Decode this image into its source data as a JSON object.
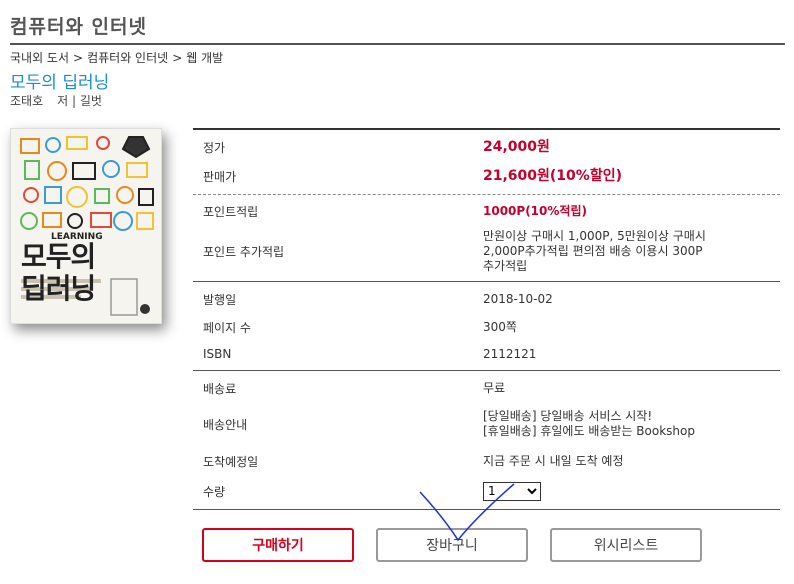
{
  "page": {
    "category_title": "컴퓨터와 인터넷"
  },
  "breadcrumb": [
    "국내외 도서",
    "컴퓨터와 인터넷",
    "웹 개발"
  ],
  "book": {
    "title": "모두의 딥러닝",
    "author": "조태호",
    "author_role": "저 | 길벗",
    "cover_title_line1": "모두의",
    "cover_title_line2": "딥러닝"
  },
  "info": {
    "price": {
      "label": "정가",
      "value": "24,000원"
    },
    "sale_price": {
      "label": "판매가",
      "value": "21,600원(10%할인)"
    },
    "points": {
      "label": "포인트적립",
      "value": "1000P(10%적립)"
    },
    "extra_points": {
      "label": "포인트 추가적립",
      "value_line1": "만원이상 구매시 1,000P, 5만원이상 구매시",
      "value_line2": "2,000P추가적립 편의점 배송 이용시 300P",
      "value_line3": "추가적립"
    },
    "pub_date": {
      "label": "발행일",
      "value": "2018-10-02"
    },
    "pages": {
      "label": "페이지 수",
      "value": "300쪽"
    },
    "isbn": {
      "label": "ISBN",
      "value": "2112121"
    },
    "shipping_fee": {
      "label": "배송료",
      "value": "무료"
    },
    "shipping_info": {
      "label": "배송안내",
      "value_line1": "[당일배송] 당일배송 서비스 시작!",
      "value_line2": "[휴일배송] 휴일에도 배송받는 Bookshop"
    },
    "arrival": {
      "label": "도착예정일",
      "value": "지금 주문 시 내일 도착 예정"
    },
    "quantity": {
      "label": "수량",
      "selected": "1",
      "options": [
        "1"
      ]
    }
  },
  "actions": {
    "buy_label": "구매하기",
    "cart_label": "장바구니",
    "wishlist_label": "위시리스트"
  },
  "colors": {
    "accent_red": "#d6001c",
    "link_blue": "#1a8fd0",
    "annotation_blue": "#1f2fd6"
  }
}
